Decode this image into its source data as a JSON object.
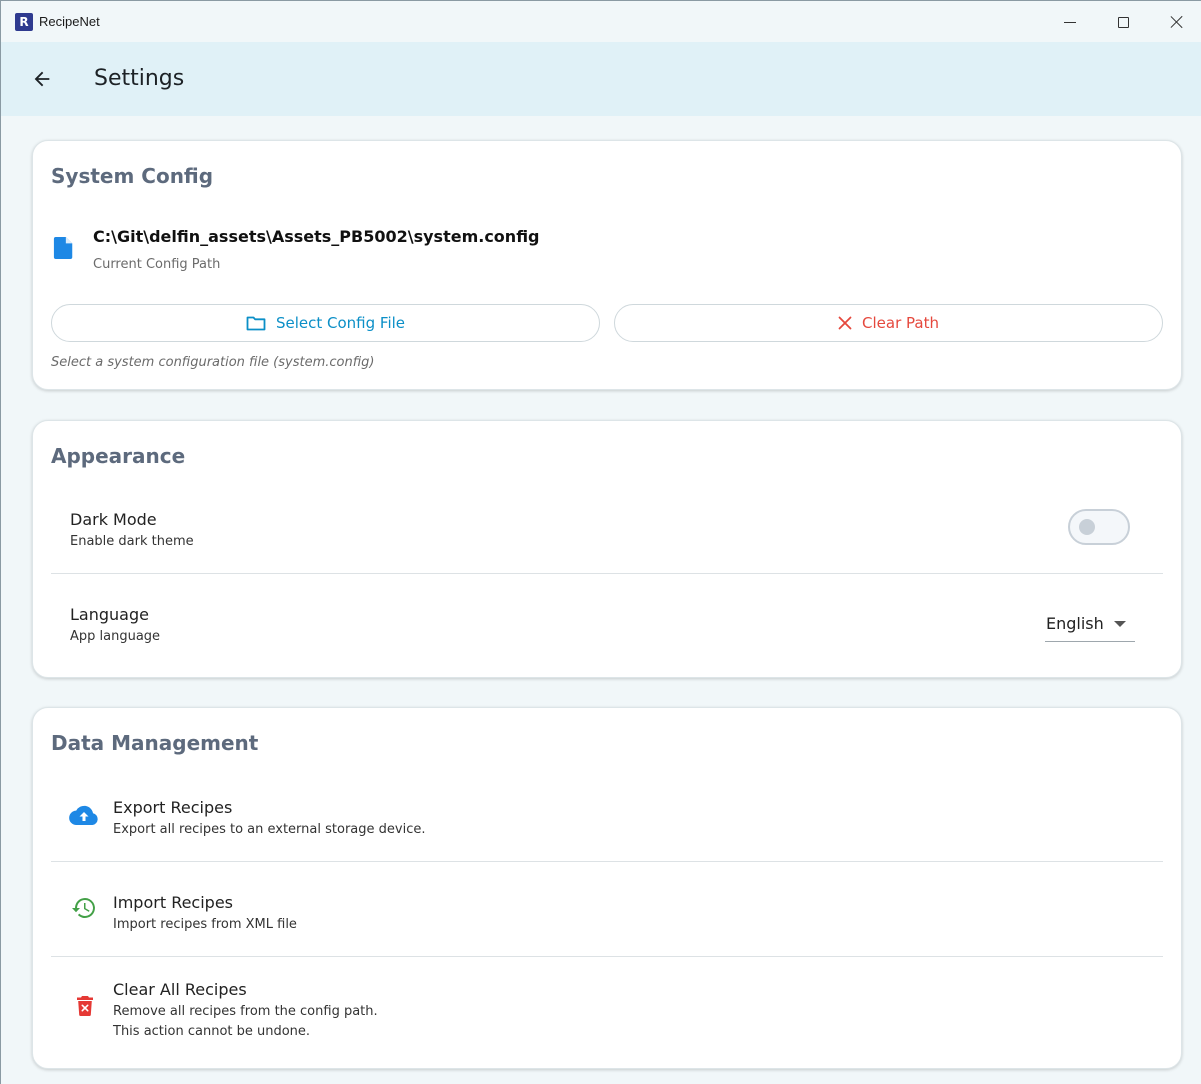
{
  "window": {
    "app_icon_letter": "R",
    "title": "RecipeNet"
  },
  "appbar": {
    "title": "Settings"
  },
  "system_config": {
    "title": "System Config",
    "path": "C:\\Git\\delfin_assets\\Assets_PB5002\\system.config",
    "path_caption": "Current Config Path",
    "select_label": "Select Config File",
    "clear_label": "Clear Path",
    "hint": "Select a system configuration file (system.config)"
  },
  "appearance": {
    "title": "Appearance",
    "dark_mode": {
      "label": "Dark Mode",
      "description": "Enable dark theme",
      "enabled": false
    },
    "language": {
      "label": "Language",
      "description": "App language",
      "selected": "English"
    }
  },
  "data_management": {
    "title": "Data Management",
    "items": [
      {
        "label": "Export Recipes",
        "description": "Export all recipes to an external storage device.",
        "icon": "cloud-upload-icon",
        "color": "#1e88e5"
      },
      {
        "label": "Import Recipes",
        "description": "Import recipes from XML file",
        "icon": "history-icon",
        "color": "#43a047"
      },
      {
        "label": "Clear All Recipes",
        "description": "Remove all recipes from the config path.",
        "description_2": "This action cannot be undone.",
        "icon": "delete-forever-icon",
        "color": "#e53935"
      }
    ]
  },
  "colors": {
    "accent": "#0b8fc7",
    "danger": "#e5483d",
    "section_title": "#5d6a7d",
    "appbar_bg": "#e0f1f7"
  }
}
